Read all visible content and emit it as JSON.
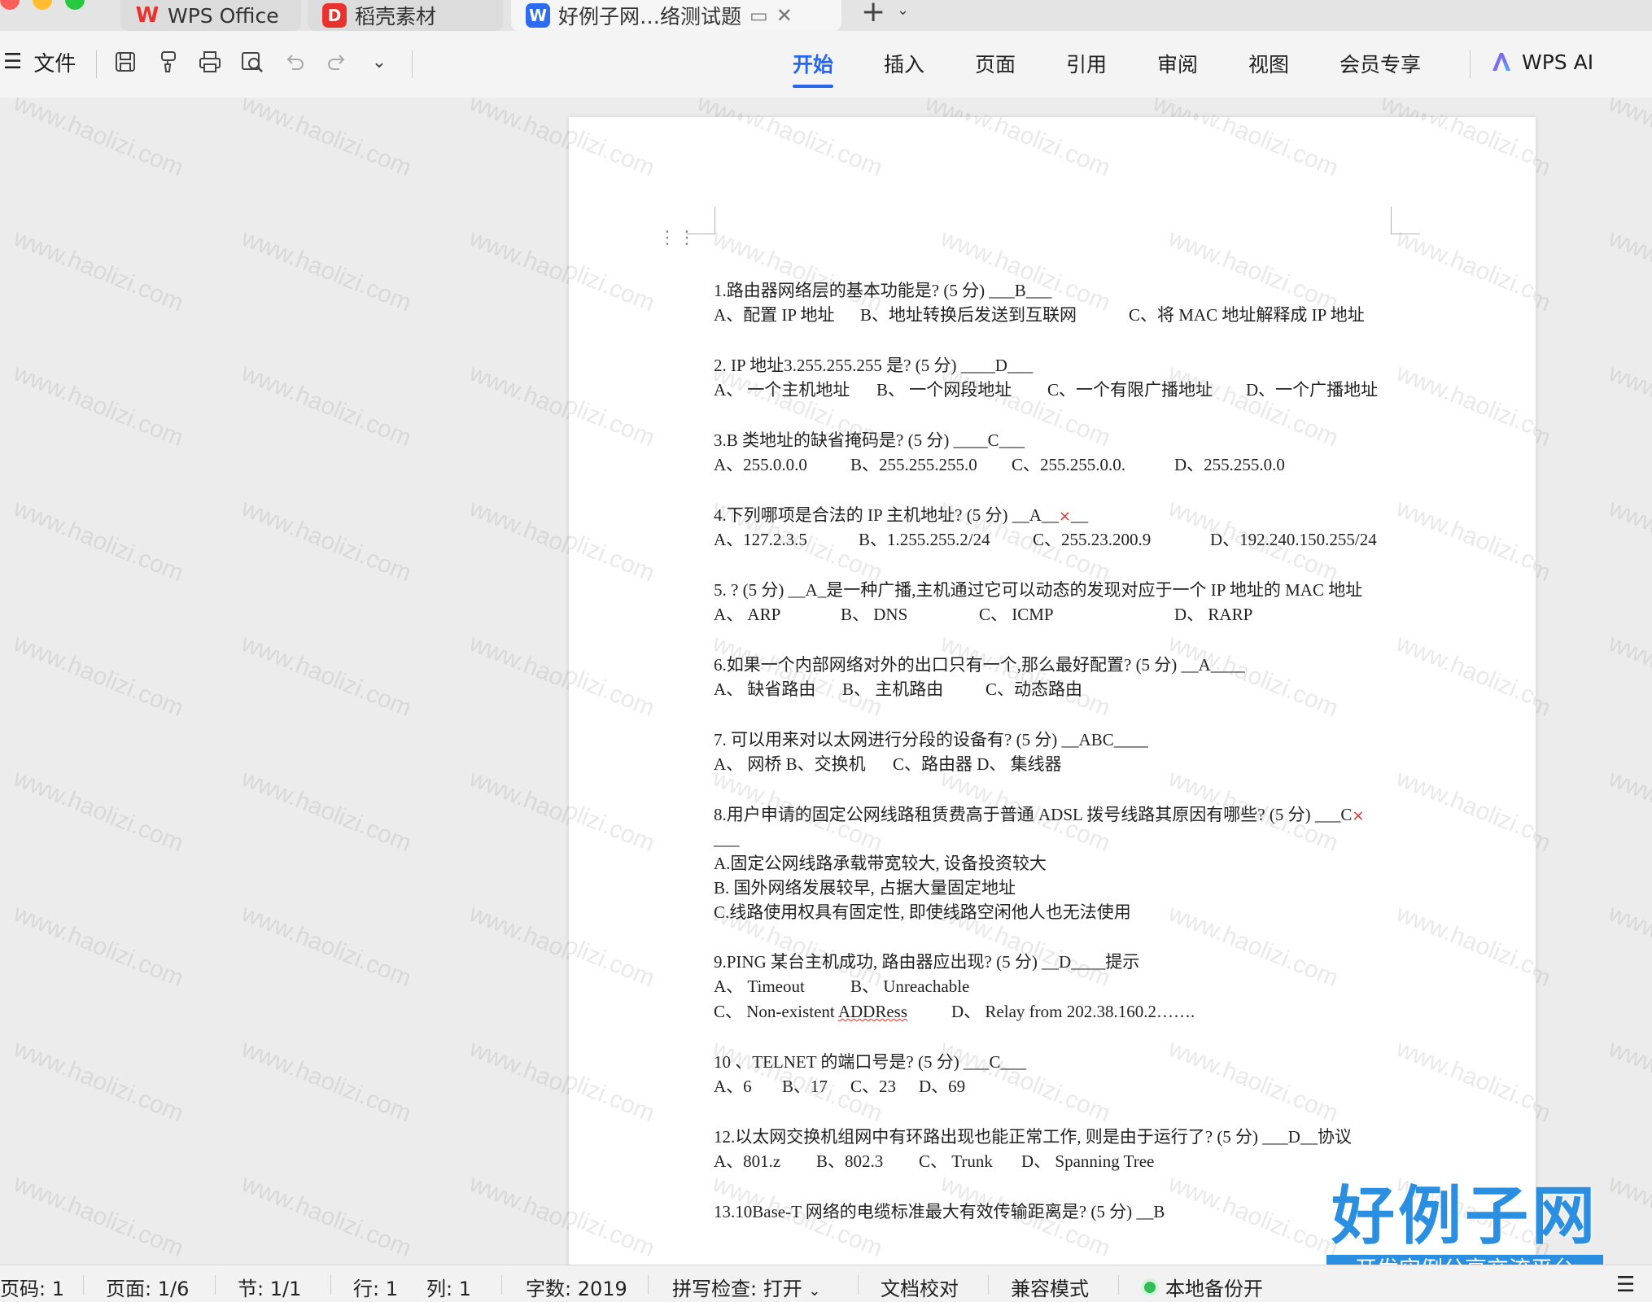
{
  "tabs": [
    {
      "label": "WPS Office",
      "icon": "wps-logo-icon",
      "color": "#e8322d"
    },
    {
      "label": "稻壳素材",
      "icon": "docer-logo-icon",
      "color": "#e8322d"
    },
    {
      "label": "好例子网…络测试题",
      "icon": "word-doc-icon",
      "color": "#2b6cf0",
      "active": true
    }
  ],
  "toolbar": {
    "file_label": "文件",
    "menu": [
      "开始",
      "插入",
      "页面",
      "引用",
      "审阅",
      "视图",
      "会员专享"
    ],
    "active_menu": "开始",
    "ai_label": "WPS AI",
    "accent": "#2766f0"
  },
  "watermark": "www.haolizi.com",
  "document": {
    "questions": [
      {
        "q": "1.路由器网络层的基本功能是? (5 分) ___B___",
        "opts": [
          "A、配置 IP 地址",
          "B、地址转换后发送到互联网",
          "C、将 MAC 地址解释成 IP 地址"
        ]
      },
      {
        "q": "2. IP 地址3.255.255.255 是? (5 分) ____D___",
        "opts": [
          "A、 一个主机地址",
          "B、 一个网段地址",
          "C、一个有限广播地址",
          "D、一个广播地址"
        ]
      },
      {
        "q": "3.B 类地址的缺省掩码是? (5 分) ____C___",
        "opts": [
          "A、255.0.0.0",
          "B、255.255.255.0",
          "C、255.255.0.0.",
          "D、255.255.0.0"
        ]
      },
      {
        "q": "4.下列哪项是合法的 IP 主机地址? (5 分) __A__",
        "mark": "×",
        "q_tail": "__",
        "opts": [
          "A、127.2.3.5",
          "B、1.255.255.2/24",
          "C、255.23.200.9",
          "D、192.240.150.255/24"
        ]
      },
      {
        "q": "5. ? (5 分) __A_是一种广播,主机通过它可以动态的发现对应于一个 IP 地址的 MAC 地址",
        "opts": [
          "A、 ARP",
          "B、 DNS",
          "C、 ICMP",
          "D、 RARP"
        ]
      },
      {
        "q": "6.如果一个内部网络对外的出口只有一个,那么最好配置? (5 分) __A____",
        "opts": [
          "A、 缺省路由",
          "B、 主机路由",
          "C、动态路由"
        ]
      },
      {
        "q": "7. 可以用来对以太网进行分段的设备有? (5 分) __ABC____",
        "opts": [
          "A、 网桥 B、交换机",
          "C、路由器 D、 集线器"
        ]
      },
      {
        "q": "8.用户申请的固定公网线路租赁费高于普通 ADSL 拨号线路其原因有哪些? (5 分) ___C",
        "mark": "×",
        "q_cont": "___",
        "lines": [
          "A.固定公网线路承载带宽较大, 设备投资较大",
          "B. 国外网络发展较早, 占据大量固定地址",
          "C.线路使用权具有固定性, 即使线路空闲他人也无法使用"
        ]
      },
      {
        "q": "9.PING 某台主机成功, 路由器应出现? (5 分) __D____提示",
        "opts": [
          "A、 Timeout",
          "B、 Unreachable"
        ],
        "opts2": [
          "C、 Non-existent ADDRess",
          "D、 Relay from 202.38.160.2……."
        ]
      },
      {
        "q": "10 、TELNET 的端口号是? (5 分) ___C___",
        "opts": [
          "A、6",
          "B、17",
          "C、23",
          "D、69"
        ]
      },
      {
        "q": "12.以太网交换机组网中有环路出现也能正常工作, 则是由于运行了? (5 分) ___D__协议",
        "opts": [
          "A、801.z",
          "B、802.3",
          "C、 Trunk",
          "D、 Spanning Tree"
        ]
      },
      {
        "q": "13.10Base-T 网络的电缆标准最大有效传输距离是? (5 分) __B"
      }
    ]
  },
  "brand": {
    "title": "好例子网",
    "subtitle": "开发实例分享交流平台",
    "color": "#2a8fe0"
  },
  "status": {
    "page_code": "页码: 1",
    "page": "页面: 1/6",
    "section": "节: 1/1",
    "row": "行: 1",
    "col": "列: 1",
    "words": "字数: 2019",
    "spell": "拼写检查: 打开",
    "proof": "文档校对",
    "compat": "兼容模式",
    "backup": "本地备份开"
  }
}
